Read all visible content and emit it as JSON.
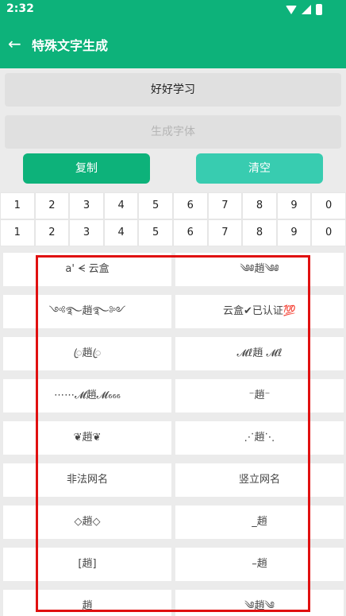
{
  "status_bar": {
    "time": "2:32"
  },
  "app_bar": {
    "title": "特殊文字生成",
    "back_icon": "arrow-left-icon"
  },
  "input": {
    "value": "好好学习"
  },
  "output": {
    "placeholder": "生成字体"
  },
  "buttons": {
    "copy": "复制",
    "clear": "清空"
  },
  "number_rows": [
    [
      "1",
      "2",
      "3",
      "4",
      "5",
      "6",
      "7",
      "8",
      "9",
      "0"
    ],
    [
      "1",
      "2",
      "3",
      "4",
      "5",
      "6",
      "7",
      "8",
      "9",
      "0"
    ]
  ],
  "styles": [
    {
      "left": "a' ᗕ 云盒",
      "right": "༄༅趙༄༅"
    },
    {
      "left": "༺࿐趙࿐༻",
      "right": "云盒✔已认证💯"
    },
    {
      "left": "ꦿ趙ꦿ",
      "right": "𝓜ℓ趙 𝓜ℓ"
    },
    {
      "left": "⋯⋯𝓜趙𝓜₆₆₆",
      "right": "⁻趙⁻"
    },
    {
      "left": "❦趙❦",
      "right": "⋰趙⋱"
    },
    {
      "left": "非法网名",
      "right": "竖立网名"
    },
    {
      "left": "◇趙◇",
      "right": "_趙"
    },
    {
      "left": "[趙]",
      "right": "–趙"
    },
    {
      "left": "趙",
      "right": "༄趙༄"
    }
  ],
  "colors": {
    "primary": "#0db27a",
    "secondary": "#38ccb0",
    "highlight": "#e01010"
  }
}
